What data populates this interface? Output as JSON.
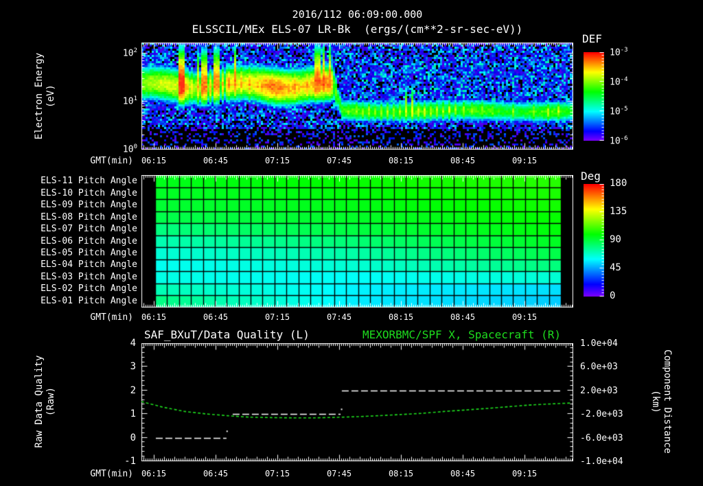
{
  "page": {
    "bg": "#000000",
    "fg": "#ffffff",
    "green": "#1edc1e"
  },
  "header": {
    "timestamp": "2016/112 06:09:00.000",
    "plot_title": "ELSSCIL/MEx ELS-07 LR-Bk  (ergs/(cm**2-sr-sec-eV))"
  },
  "time_axis": {
    "label": "GMT(min)",
    "ticks": [
      "06:15",
      "06:45",
      "07:15",
      "07:45",
      "08:15",
      "08:45",
      "09:15"
    ],
    "start_gmt": "06:09",
    "end_gmt": "09:39",
    "first_tick_offset_min": 6,
    "tick_step_min": 30
  },
  "panel_energy": {
    "ylabel_line1": "Electron Energy",
    "ylabel_line2": "(eV)",
    "colorbar_title": "DEF"
  },
  "panel_pitch": {
    "colorbar_title": "Deg"
  },
  "panel_quality": {
    "title_left": "SAF_BXuT/Data Quality (L)",
    "title_right": "MEXORBMC/SPF X, Spacecraft (R)",
    "ylabel_line1": "Raw Data Quality",
    "ylabel_line2": "(Raw)",
    "yrlabel_line1": "Component Distance",
    "yrlabel_line2": "(km)"
  },
  "chart_data": [
    {
      "type": "heatmap",
      "id": "electron-energy-spectrogram",
      "title": "ELSSCIL/MEx ELS-07 LR-Bk (ergs/(cm**2-sr-sec-eV))",
      "xlabel": "GMT(min)",
      "ylabel": "Electron Energy (eV)",
      "x_range_gmt": [
        "06:09",
        "09:39"
      ],
      "y_scale": "log",
      "y_min_eV": 1,
      "y_max_eV": 166,
      "y_ticks": [
        {
          "base": "10",
          "exp": "2"
        },
        {
          "base": "10",
          "exp": "1"
        },
        {
          "base": "10",
          "exp": "0"
        }
      ],
      "colorbar": {
        "title": "DEF",
        "min": 1e-06,
        "max": 0.001,
        "ticks": [
          {
            "base": "10",
            "exp": "-3"
          },
          {
            "base": "10",
            "exp": "-4"
          },
          {
            "base": "10",
            "exp": "-5"
          },
          {
            "base": "10",
            "exp": "-6"
          }
        ]
      },
      "features": {
        "main_band_eV": [
          12,
          50
        ],
        "main_band_until_min": 95,
        "main_band_peak_flux": 0.0002,
        "post_band_eV": [
          4,
          10
        ],
        "post_band_flux": 2e-05,
        "background_flux": 1e-06
      },
      "render": {
        "streaks1": [
          {
            "t": 19,
            "w": 1.2,
            "a": -3.55,
            "hi": 1
          },
          {
            "t": 21.5,
            "w": 0.8,
            "a": -4.0,
            "hi": 0
          },
          {
            "t": 24,
            "w": 0.6,
            "a": -4.15,
            "hi": 0
          },
          {
            "t": 27,
            "w": 0.8,
            "a": -3.95,
            "hi": 1
          },
          {
            "t": 30,
            "w": 1.0,
            "a": -3.8,
            "hi": 1
          },
          {
            "t": 33,
            "w": 0.8,
            "a": -3.95,
            "hi": 0
          },
          {
            "t": 36,
            "w": 1.0,
            "a": -3.8,
            "hi": 1
          },
          {
            "t": 39,
            "w": 0.7,
            "a": -3.95,
            "hi": 0
          },
          {
            "t": 42,
            "w": 0.8,
            "a": -3.85,
            "hi": 0
          },
          {
            "t": 45,
            "w": 0.9,
            "a": -3.8,
            "hi": 1
          },
          {
            "t": 48,
            "w": 0.7,
            "a": -3.95,
            "hi": 0
          },
          {
            "t": 52,
            "w": 0.7,
            "a": -3.9,
            "hi": 0
          },
          {
            "t": 56,
            "w": 0.6,
            "a": -3.95,
            "hi": 0
          },
          {
            "t": 62,
            "w": 0.8,
            "a": -3.85,
            "hi": 0
          },
          {
            "t": 68,
            "w": 0.7,
            "a": -3.9,
            "hi": 0
          },
          {
            "t": 74,
            "w": 0.8,
            "a": -3.85,
            "hi": 0
          },
          {
            "t": 80,
            "w": 0.7,
            "a": -3.9,
            "hi": 0
          },
          {
            "t": 85,
            "w": 1.0,
            "a": -3.75,
            "hi": 1
          },
          {
            "t": 88,
            "w": 0.8,
            "a": -3.7,
            "hi": 1
          },
          {
            "t": 91,
            "w": 0.9,
            "a": -3.75,
            "hi": 1
          }
        ],
        "streaks2": [
          {
            "t": 100,
            "a": -4.5,
            "hi": 0
          },
          {
            "t": 104,
            "a": -4.4,
            "hi": 0
          },
          {
            "t": 107,
            "a": -4.45,
            "hi": 0
          },
          {
            "t": 110,
            "a": -4.35,
            "hi": 0
          },
          {
            "t": 113,
            "a": -4.45,
            "hi": 0
          },
          {
            "t": 116,
            "a": -4.35,
            "hi": 0
          },
          {
            "t": 119,
            "a": -4.3,
            "hi": 0
          },
          {
            "t": 122,
            "a": -4.4,
            "hi": 0
          },
          {
            "t": 125,
            "a": -4.3,
            "hi": 0
          },
          {
            "t": 128,
            "a": -4.25,
            "hi": 1
          },
          {
            "t": 131,
            "a": -4.2,
            "hi": 1
          },
          {
            "t": 134,
            "a": -4.3,
            "hi": 0
          },
          {
            "t": 137,
            "a": -4.25,
            "hi": 0
          },
          {
            "t": 140,
            "a": -4.35,
            "hi": 0
          },
          {
            "t": 143,
            "a": -4.3,
            "hi": 0
          },
          {
            "t": 146,
            "a": -4.35,
            "hi": 0
          },
          {
            "t": 149,
            "a": -4.3,
            "hi": 0
          },
          {
            "t": 152,
            "a": -4.4,
            "hi": 0
          },
          {
            "t": 156,
            "a": -4.35,
            "hi": 0
          },
          {
            "t": 160,
            "a": -4.45,
            "hi": 0
          },
          {
            "t": 165,
            "a": -4.4,
            "hi": 0
          },
          {
            "t": 170,
            "a": -4.5,
            "hi": 0
          },
          {
            "t": 180,
            "a": -4.45,
            "hi": 0
          },
          {
            "t": 190,
            "a": -4.4,
            "hi": 0
          },
          {
            "t": 197,
            "a": -4.35,
            "hi": 0
          },
          {
            "t": 202,
            "a": -4.3,
            "hi": 0
          }
        ]
      }
    },
    {
      "type": "heatmap",
      "id": "pitch-angle-grid",
      "xlabel": "GMT(min)",
      "data_start_min": 6.5,
      "data_end_min": 203.5,
      "columns": 34,
      "colorbar": {
        "title": "Deg",
        "min": 0,
        "max": 180,
        "ticks": [
          "180",
          "135",
          "90",
          "45",
          "0"
        ]
      },
      "rows": [
        {
          "label": "ELS-11 Pitch Angle",
          "deg": [
            96,
            101,
            106
          ]
        },
        {
          "label": "ELS-10 Pitch Angle",
          "deg": [
            94,
            99,
            104
          ]
        },
        {
          "label": "ELS-09 Pitch Angle",
          "deg": [
            92,
            97,
            103
          ]
        },
        {
          "label": "ELS-08 Pitch Angle",
          "deg": [
            88,
            94,
            101
          ]
        },
        {
          "label": "ELS-07 Pitch Angle",
          "deg": [
            80,
            90,
            99
          ]
        },
        {
          "label": "ELS-06 Pitch Angle",
          "deg": [
            72,
            82,
            95
          ]
        },
        {
          "label": "ELS-05 Pitch Angle",
          "deg": [
            66,
            74,
            89
          ]
        },
        {
          "label": "ELS-04 Pitch Angle",
          "deg": [
            62,
            67,
            81
          ]
        },
        {
          "label": "ELS-03 Pitch Angle",
          "deg": [
            64,
            61,
            67
          ]
        },
        {
          "label": "ELS-02 Pitch Angle",
          "deg": [
            72,
            58,
            55
          ]
        },
        {
          "label": "ELS-01 Pitch Angle",
          "deg": [
            80,
            57,
            52
          ]
        }
      ]
    },
    {
      "type": "line",
      "id": "quality-and-spacecraft",
      "xlabel": "GMT(min)",
      "left_axis": {
        "label": "Raw Data Quality (Raw)",
        "min": -1,
        "max": 4,
        "ticks": [
          "4",
          "3",
          "2",
          "1",
          "0",
          "-1"
        ]
      },
      "right_axis": {
        "label": "Component Distance (km)",
        "min": -10000,
        "max": 10000,
        "ticks": [
          "1.0e+04",
          "6.0e+03",
          "2.0e+03",
          "-2.0e+03",
          "-6.0e+03",
          "-1.0e+04"
        ]
      },
      "series": [
        {
          "name": "SAF_BXuT/Data Quality (L)",
          "axis": "left",
          "color": "#ffffff",
          "style": "dashed",
          "segments": [
            {
              "value": 0,
              "t_from_min": 7.0,
              "t_to_min": 41.3
            },
            {
              "value": 1,
              "t_from_min": 44.3,
              "t_to_min": 96.7
            },
            {
              "value": 2,
              "t_from_min": 97.3,
              "t_to_min": 203.3
            }
          ],
          "isolated_points": [
            {
              "t_min": 41.6,
              "value": 0.27
            },
            {
              "t_min": 97.2,
              "value": 1.2
            }
          ]
        },
        {
          "name": "MEXORBMC/SPF X, Spacecraft (R)",
          "axis": "right",
          "color": "#1edc1e",
          "style": "dotted",
          "t_min": [
            0,
            10,
            21,
            31,
            42,
            52,
            63,
            73,
            84,
            94,
            105,
            115,
            126,
            136,
            147,
            157,
            168,
            178,
            188,
            199,
            209
          ],
          "km": [
            120,
            -800,
            -1560,
            -1960,
            -2280,
            -2520,
            -2600,
            -2640,
            -2640,
            -2560,
            -2440,
            -2280,
            -2080,
            -1880,
            -1560,
            -1320,
            -1040,
            -760,
            -480,
            -280,
            -120
          ]
        }
      ]
    }
  ]
}
